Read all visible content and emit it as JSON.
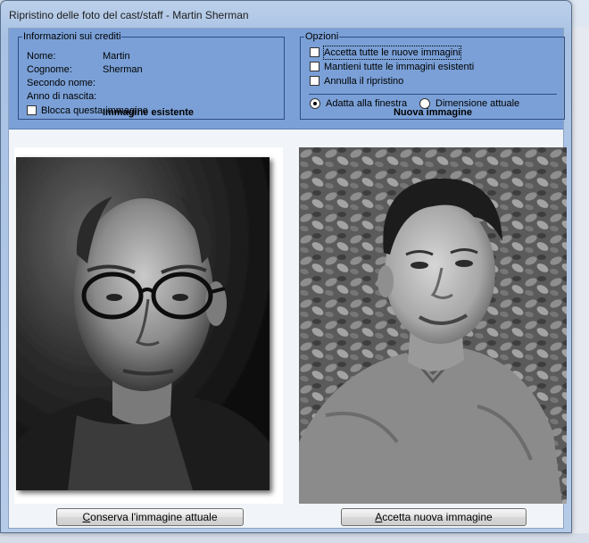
{
  "window": {
    "title": "Ripristino delle foto del cast/staff - Martin Sherman"
  },
  "credits": {
    "legend": "Informazioni sui crediti",
    "fields": [
      {
        "label": "Nome:",
        "value": "Martin"
      },
      {
        "label": "Cognome:",
        "value": "Sherman"
      },
      {
        "label": "Secondo nome:",
        "value": ""
      },
      {
        "label": "Anno di nascita:",
        "value": ""
      }
    ],
    "lock_label": "Blocca questa immagine",
    "lock_checked": false
  },
  "options": {
    "legend": "Opzioni",
    "checks": [
      {
        "label": "Accetta tutte le nuove immagini",
        "checked": false
      },
      {
        "label": "Mantieni tutte le immagini esistenti",
        "checked": false
      },
      {
        "label": "Annulla il ripristino",
        "checked": false
      }
    ],
    "radios": [
      {
        "label": "Adatta alla finestra",
        "selected": true
      },
      {
        "label": "Dimensione attuale",
        "selected": false
      }
    ]
  },
  "existing": {
    "heading": "Immagine esistente",
    "button_first": "C",
    "button_rest": "onserva l'immagine attuale"
  },
  "new_image": {
    "heading": "Nuova immagine",
    "button_first": "A",
    "button_rest": "ccetta nuova immagine"
  }
}
